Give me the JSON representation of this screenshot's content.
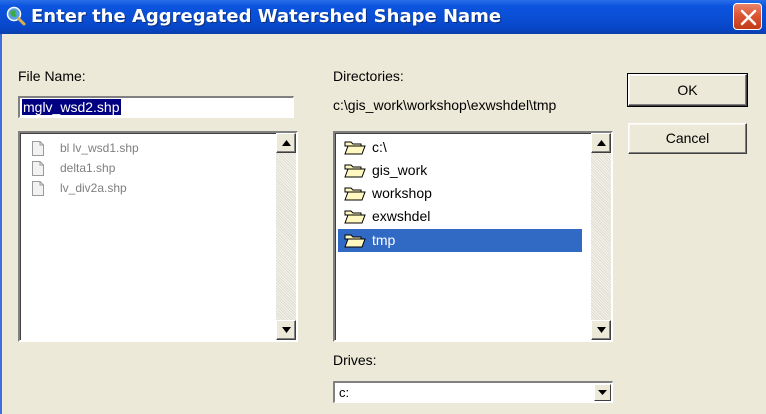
{
  "window": {
    "title": "Enter the Aggregated Watershed Shape Name",
    "title_icon": "magnifier-globe-icon",
    "close_icon": "close-icon",
    "titlebar_color": "#0a4fd6",
    "close_color": "#dd5533"
  },
  "file_name": {
    "label": "File Name:",
    "value": "mglv_wsd2.shp"
  },
  "files": {
    "items": [
      {
        "name": "bl lv_wsd1.shp",
        "icon": "document-icon"
      },
      {
        "name": "delta1.shp",
        "icon": "document-icon"
      },
      {
        "name": "lv_div2a.shp",
        "icon": "document-icon"
      }
    ]
  },
  "directories": {
    "label": "Directories:",
    "current_path": "c:\\gis_work\\workshop\\exwshdel\\tmp",
    "items": [
      {
        "name": "c:\\",
        "icon": "open-folder-icon",
        "selected": false
      },
      {
        "name": "gis_work",
        "icon": "open-folder-icon",
        "selected": false
      },
      {
        "name": "workshop",
        "icon": "open-folder-icon",
        "selected": false
      },
      {
        "name": "exwshdel",
        "icon": "open-folder-icon",
        "selected": false
      },
      {
        "name": "tmp",
        "icon": "open-folder-icon",
        "selected": true
      }
    ],
    "selection_color": "#316ac5"
  },
  "drives": {
    "label": "Drives:",
    "selected": "c:"
  },
  "buttons": {
    "ok_label": "OK",
    "cancel_label": "Cancel"
  }
}
